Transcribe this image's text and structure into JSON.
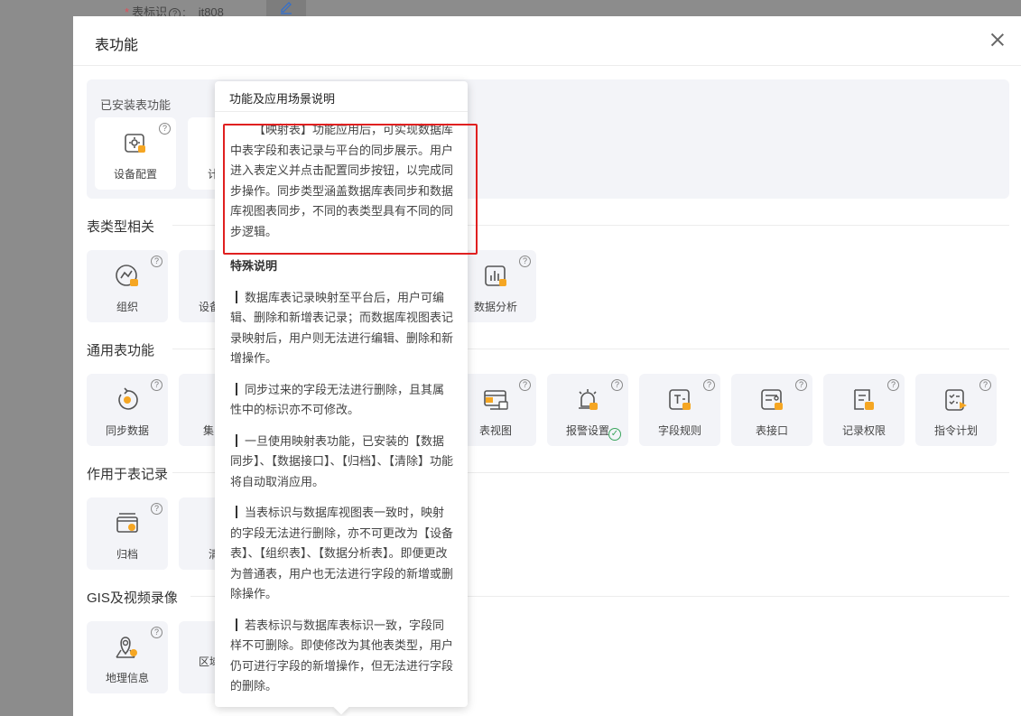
{
  "background_form": {
    "required_mark": "*",
    "field_label": "表标识",
    "help_mark": "?",
    "colon": ":",
    "field_value": "jt808"
  },
  "modal": {
    "title": "表功能"
  },
  "installed": {
    "title": "已安装表功能",
    "cards": [
      {
        "label": "设备配置",
        "icon": "device-config-icon"
      },
      {
        "label": "计",
        "icon": "plan-icon"
      }
    ]
  },
  "sections": [
    {
      "title": "表类型相关",
      "cards": [
        {
          "label": "组织",
          "icon": "org-icon"
        },
        {
          "label": "设备",
          "icon": "device-icon"
        },
        {
          "label": "数据分析",
          "icon": "data-analysis-icon"
        }
      ]
    },
    {
      "title": "通用表功能",
      "cards": [
        {
          "label": "同步数据",
          "icon": "sync-icon"
        },
        {
          "label": "集",
          "icon": "collect-icon"
        },
        {
          "label": "表视图",
          "icon": "table-view-icon"
        },
        {
          "label": "报警设置",
          "icon": "alarm-icon",
          "installed": true
        },
        {
          "label": "字段规则",
          "icon": "field-rule-icon"
        },
        {
          "label": "表接口",
          "icon": "table-api-icon"
        },
        {
          "label": "记录权限",
          "icon": "record-permission-icon"
        },
        {
          "label": "指令计划",
          "icon": "command-plan-icon"
        }
      ]
    },
    {
      "title": "作用于表记录",
      "cards": [
        {
          "label": "归档",
          "icon": "archive-icon"
        },
        {
          "label": "清",
          "icon": "clean-icon"
        }
      ]
    },
    {
      "title": "GIS及视频录像",
      "cards": [
        {
          "label": "地理信息",
          "icon": "geo-icon"
        },
        {
          "label": "区域",
          "icon": "area-icon"
        }
      ]
    }
  ],
  "popover": {
    "title": "功能及应用场景说明",
    "intro": "【映射表】功能应用后，可实现数据库中表字段和表记录与平台的同步展示。用户进入表定义并点击配置同步按钮，以完成同步操作。同步类型涵盖数据库表同步和数据库视图表同步，不同的表类型具有不同的同步逻辑。",
    "special_title": "特殊说明",
    "notes": [
      "数据库表记录映射至平台后，用户可编辑、删除和新增表记录；而数据库视图表记录映射后，用户则无法进行编辑、删除和新增操作。",
      "同步过来的字段无法进行删除，且其属性中的标识亦不可修改。",
      "一旦使用映射表功能，已安装的【数据同步】、【数据接口】、【归档】、【清除】功能将自动取消应用。",
      "当表标识与数据库视图表一致时，映射的字段无法进行删除，亦不可更改为【设备表】、【组织表】、【数据分析表】。即便更改为普通表，用户也无法进行字段的新增或删除操作。",
      "若表标识与数据库表标识一致，字段同样不可删除。即使修改为其他表类型，用户仍可进行字段的新增操作，但无法进行字段的删除。"
    ]
  },
  "colors": {
    "accent": "#f5a623",
    "icon_stroke": "#555555",
    "highlight": "#e02020",
    "success": "#3aa55d"
  }
}
